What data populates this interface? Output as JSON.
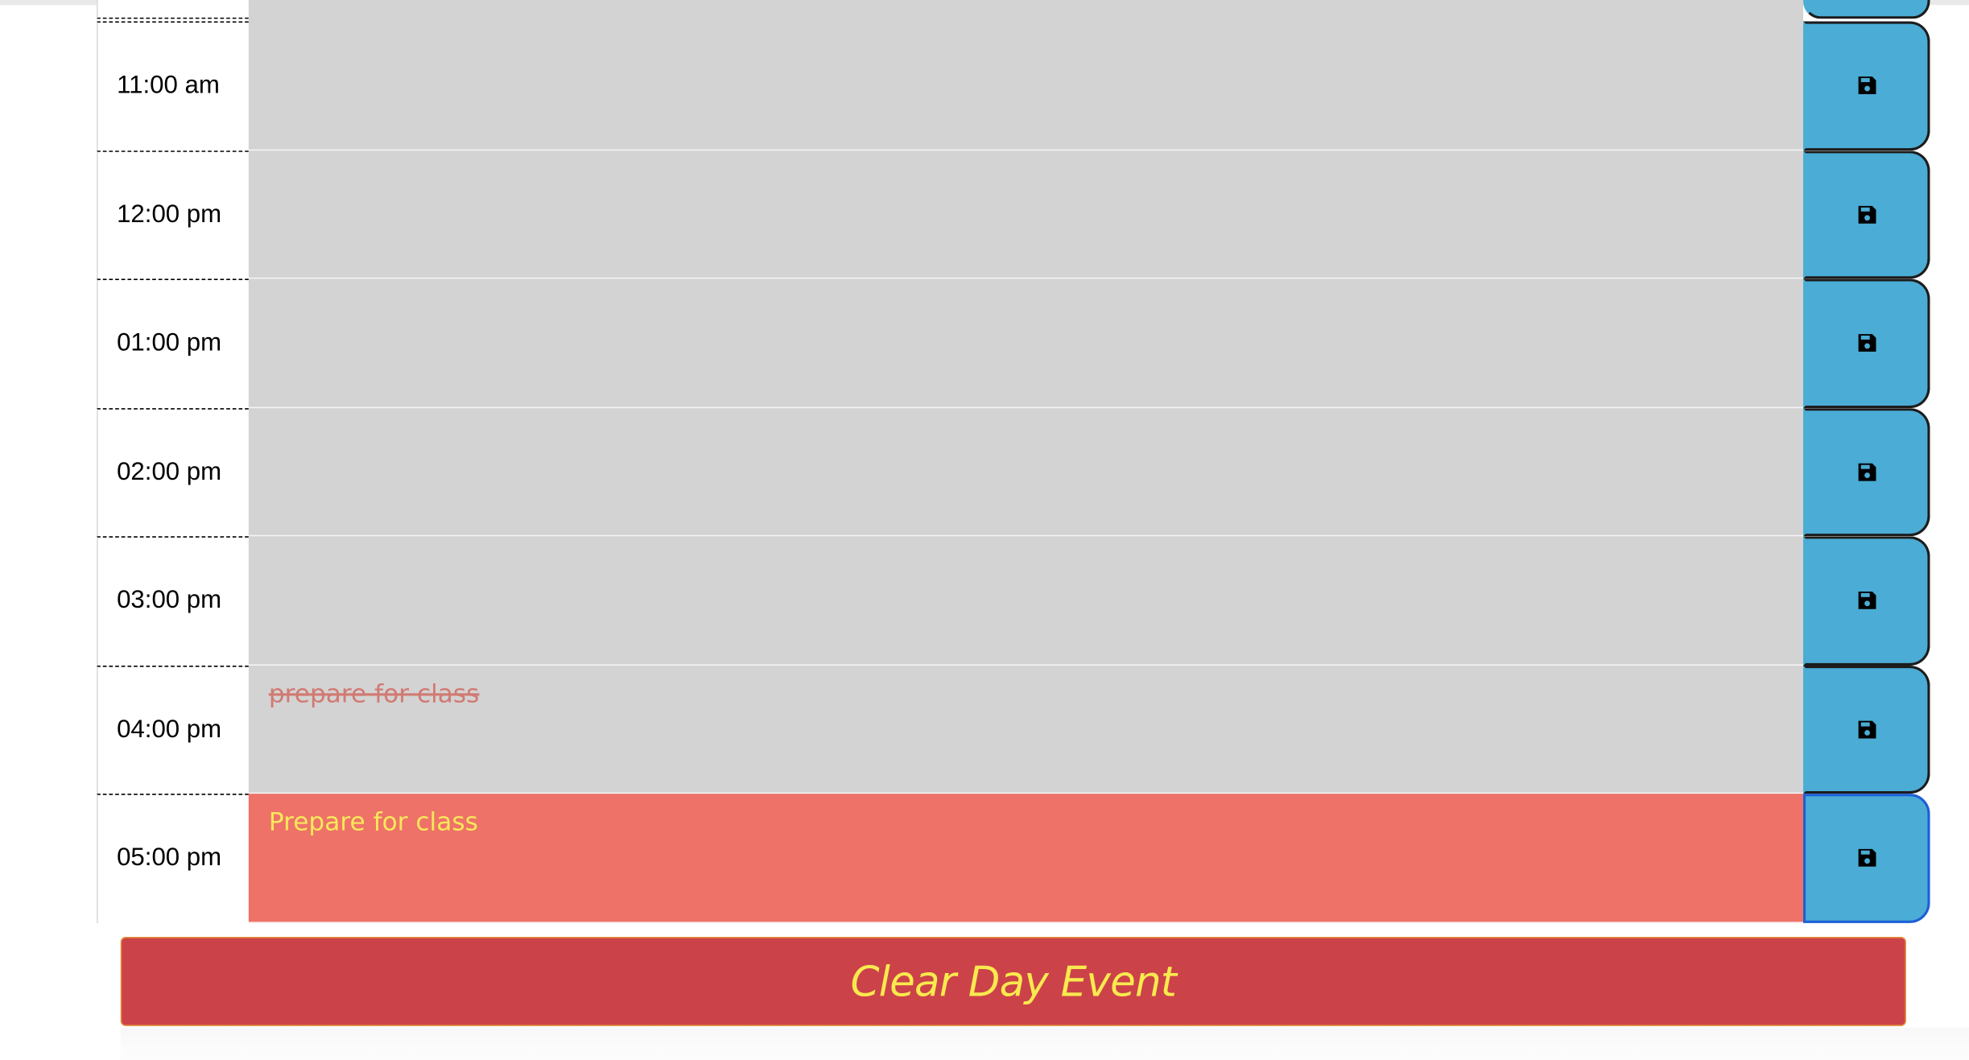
{
  "colors": {
    "past": "#d3d3d3",
    "present": "#ee7268",
    "save_button": "#4bacd5",
    "clear_button": "#cc4249",
    "clear_text": "#f8ea4e"
  },
  "icons": {
    "save": "floppy-disk-icon"
  },
  "schedule": {
    "rows": [
      {
        "hour": "11:00 am",
        "text": "",
        "state": "past"
      },
      {
        "hour": "12:00 pm",
        "text": "",
        "state": "past"
      },
      {
        "hour": "01:00 pm",
        "text": "",
        "state": "past"
      },
      {
        "hour": "02:00 pm",
        "text": "",
        "state": "past"
      },
      {
        "hour": "03:00 pm",
        "text": "",
        "state": "past"
      },
      {
        "hour": "04:00 pm",
        "text": "prepare for class",
        "state": "past",
        "struck_through": true
      },
      {
        "hour": "05:00 pm",
        "text": "Prepare for class",
        "state": "present"
      }
    ]
  },
  "clear_button": {
    "label": "Clear Day Event"
  }
}
